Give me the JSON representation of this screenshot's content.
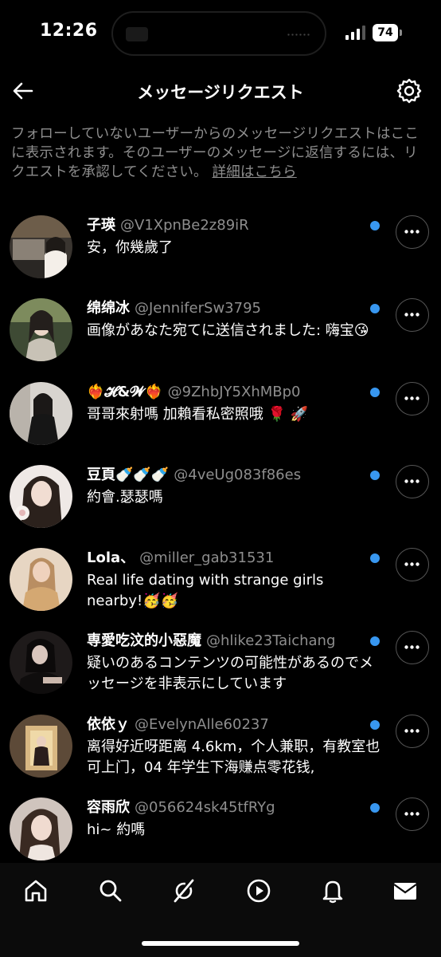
{
  "status_bar": {
    "time": "12:26",
    "battery": "74"
  },
  "header": {
    "title": "メッセージリクエスト"
  },
  "notice": {
    "text": "フォローしていないユーザーからのメッセージリクエストはここに表示されます。そのユーザーのメッセージに返信するには、リクエストを承認してください。",
    "link": "詳細はこちら"
  },
  "requests": [
    {
      "name": "子瑛",
      "handle": "@V1XpnBe2z89iR",
      "message": "安，你幾歲了",
      "unread": true
    },
    {
      "name": "绵绵冰",
      "handle": "@JenniferSw3795",
      "message": "画像があなた宛てに送信されました: 嗨宝😘",
      "unread": true
    },
    {
      "name": "❤️‍🔥𝓗&𝓦❤️‍🔥",
      "handle": "@9ZhbJY5XhMBp0",
      "message": "哥哥來射嗎 加賴看私密照哦 🌹 🚀",
      "unread": true
    },
    {
      "name": "豆頁🍼🍼🍼",
      "handle": "@4veUg083f86es",
      "message": "約會.瑟瑟嗎",
      "unread": true
    },
    {
      "name": "Lola、",
      "handle": "@miller_gab31531",
      "message": "Real life dating with strange girls nearby!🥳🥳",
      "unread": true
    },
    {
      "name": "専愛吃汶的小惡魔",
      "handle": "@hlike23Taichang",
      "message": "疑いのあるコンテンツの可能性があるのでメッセージを非表示にしています",
      "unread": true
    },
    {
      "name": "依依ｙ",
      "handle": "@EvelynAlle60237",
      "message": "离得好近呀距离 4.6km，个人兼职，有教室也可上门，04 年学生下海赚点零花钱,",
      "unread": true
    },
    {
      "name": "容雨欣",
      "handle": "@056624sk45tfRYg",
      "message": "hi~ 約嗎",
      "unread": true
    }
  ],
  "tabs": [
    "home-icon",
    "search-icon",
    "explore-icon",
    "video-icon",
    "notifications-icon",
    "messages-icon"
  ],
  "colors": {
    "background": "#000000",
    "unread_dot": "#3897f0",
    "secondary_text": "#8e8e8e"
  }
}
